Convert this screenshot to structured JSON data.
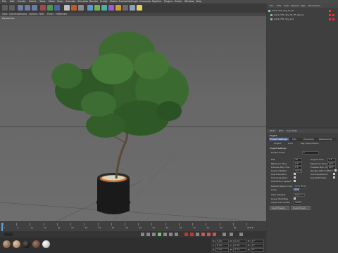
{
  "menubar": {
    "items": [
      "File",
      "Edit",
      "Create",
      "Select",
      "Tools",
      "Mesh",
      "Snap",
      "Animate",
      "Simulate",
      "Render",
      "Sculpt",
      "Motion Tracker",
      "MoGraph",
      "Character",
      "Pipeline",
      "Plugins",
      "Script",
      "Window",
      "Help"
    ]
  },
  "viewport": {
    "menu": [
      "View",
      "Cameras",
      "Display",
      "Options",
      "Filter",
      "Panel",
      "ProRender"
    ],
    "label": "Perspective"
  },
  "object_manager": {
    "menu": [
      "File",
      "Edit",
      "View",
      "Objects",
      "Tags",
      "Bookmarks"
    ],
    "objects": [
      "plant_TP1_Sky_ht_TP",
      "plant_TP1_Sky_ht_TP_leaves",
      "plant_TP1_Sky_pot"
    ]
  },
  "attributes": {
    "menu": [
      "Mode",
      "Edit",
      "User Data"
    ],
    "title": "Project",
    "tabs": [
      "Project Settings",
      "Info",
      "Dynamics",
      "Referencing"
    ],
    "sub_tabs": [
      "Project",
      "Todo",
      "Key Interpolation"
    ],
    "section": "Project Settings",
    "fields": [
      {
        "label": "Project Scale",
        "value": "1"
      },
      {
        "label": "FPS",
        "value": "30"
      },
      {
        "label": "Minimum Time",
        "value": "0 F"
      },
      {
        "label": "Preview Min Time",
        "value": "0 F"
      },
      {
        "label": "Level of Detail",
        "value": "100 %"
      },
      {
        "label": "Use Animation",
        "value": ""
      },
      {
        "label": "Use Generators",
        "value": ""
      },
      {
        "label": "Use Motion System",
        "value": ""
      },
      {
        "label": "Default Object Color",
        "value": "Gray Blue"
      },
      {
        "label": "Color",
        "value": ""
      },
      {
        "label": "View Clipping",
        "value": "Medium"
      },
      {
        "label": "Linear Workflow",
        "value": ""
      },
      {
        "label": "Input Color Profile",
        "value": "sRGB"
      }
    ],
    "right_fields": [
      {
        "label": "Project Time",
        "value": "0 F"
      },
      {
        "label": "Maximum Time",
        "value": "90 F"
      },
      {
        "label": "Preview Max Time",
        "value": "90 F"
      },
      {
        "label": "Render LOD in Editor",
        "value": ""
      },
      {
        "label": "Use Expressions",
        "value": ""
      },
      {
        "label": "Use Deformers",
        "value": ""
      }
    ],
    "buttons": [
      "Load Preset...",
      "Save Preset..."
    ]
  },
  "timeline": {
    "ticks": [
      "0",
      "5",
      "10",
      "15",
      "20",
      "25",
      "30",
      "35",
      "40",
      "45",
      "50",
      "55",
      "60",
      "65",
      "70",
      "75",
      "80",
      "85",
      "90"
    ],
    "frame": "0 F"
  },
  "materials": {
    "menu": [
      "Create",
      "Edit",
      "Function",
      "Texture"
    ],
    "swatches": [
      "#8a6a4e",
      "#b08a6c",
      "#202020",
      "#6b4c3a",
      "#c9c9c9"
    ]
  },
  "coordinates": {
    "rows": [
      [
        "X",
        "0 cm",
        "X",
        "0 cm",
        "H",
        "0 °"
      ],
      [
        "Y",
        "0 cm",
        "Y",
        "0 cm",
        "P",
        "0 °"
      ],
      [
        "Z",
        "0 cm",
        "Z",
        "0 cm",
        "B",
        "0 °"
      ]
    ],
    "apply": "Apply"
  }
}
